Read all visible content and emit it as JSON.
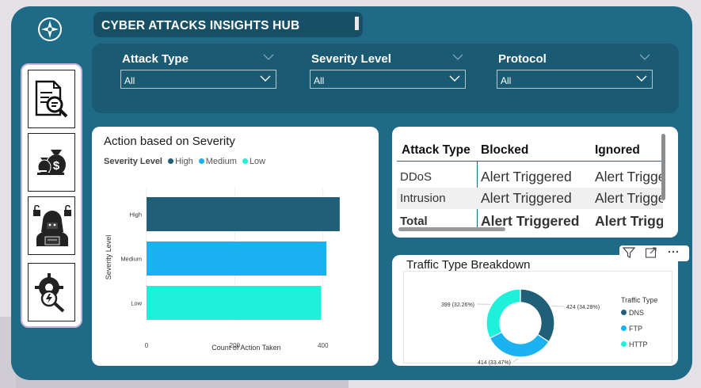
{
  "app": {
    "title": "CYBER ATTACKS INSIGHTS HUB",
    "logo_icon": "compass-star-icon"
  },
  "filters": [
    {
      "label": "Attack Type",
      "value": "All"
    },
    {
      "label": "Severity Level",
      "value": "All"
    },
    {
      "label": "Protocol",
      "value": "All"
    }
  ],
  "sidebar": {
    "items": [
      {
        "icon": "document-search-icon"
      },
      {
        "icon": "money-bags-icon"
      },
      {
        "icon": "hacker-lock-icon"
      },
      {
        "icon": "gear-search-icon"
      }
    ]
  },
  "severity_chart": {
    "title": "Action based on Severity",
    "legend_title": "Severity Level",
    "xlabel": "Count of Action Taken",
    "ylabel": "Severity Level",
    "chart_data": {
      "type": "bar",
      "orientation": "horizontal",
      "categories": [
        "High",
        "Medium",
        "Low"
      ],
      "values": [
        438,
        408,
        396
      ],
      "colors": [
        "#1f5f78",
        "#1ab2f0",
        "#1ef0da"
      ],
      "xlim": [
        0,
        440
      ],
      "xticks": [
        "0",
        "200",
        "400"
      ],
      "legend": [
        "High",
        "Medium",
        "Low"
      ]
    }
  },
  "table": {
    "headers": [
      "Attack Type",
      "Blocked",
      "Ignored"
    ],
    "rows": [
      [
        "DDoS",
        "Alert Triggered",
        "Alert Triggered"
      ],
      [
        "Intrusion",
        "Alert Triggered",
        "Alert Triggered"
      ]
    ],
    "total": [
      "Total",
      "Alert Triggered",
      "Alert Triggered"
    ]
  },
  "toolbar_icons": [
    "filter-icon",
    "focus-mode-icon",
    "more-options-icon"
  ],
  "traffic_chart": {
    "title": "Traffic Type Breakdown",
    "legend_title": "Traffic Type",
    "chart_data": {
      "type": "pie",
      "variant": "donut",
      "labels": [
        "DNS",
        "FTP",
        "HTTP"
      ],
      "values": [
        424,
        414,
        399
      ],
      "percent_labels": [
        "424 (34.28%)",
        "414 (33.47%)",
        "399 (32.26%)"
      ],
      "colors": [
        "#1f5f78",
        "#1ab2f0",
        "#1ef0da"
      ]
    }
  }
}
